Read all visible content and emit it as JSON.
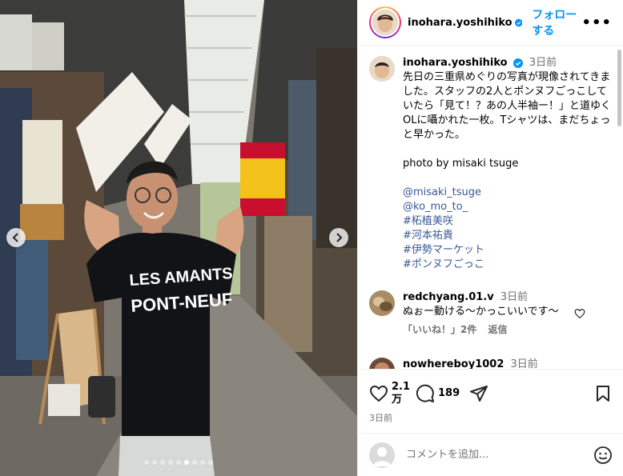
{
  "post": {
    "username": "inohara.yoshihiko",
    "follow_label": "フォローする",
    "more_label": "•••",
    "image_caption_shirt_line1": "LES AMANTS",
    "image_caption_shirt_line2": "PONT-NEUF",
    "carousel": {
      "total": 9,
      "active": 5
    }
  },
  "caption": {
    "username": "inohara.yoshihiko",
    "time": "3日前",
    "text": "先日の三重県めぐりの写真が現像されてきました。スタッフの2人とポンヌフごっこしていたら「見て！？あの人半袖ー！」と道ゆくOLに囁かれた一枚。Tシャツは、まだちょっと早かった。",
    "credit": "photo by misaki tsuge",
    "tags": [
      "@misaki_tsuge",
      "@ko_mo_to_",
      "#柘植美咲",
      "#河本祐貴",
      "#伊勢マーケット",
      "#ポンヌフごっこ"
    ]
  },
  "comments": [
    {
      "username": "redchyang.01.v",
      "time": "3日前",
      "text": "ぬぉー動ける〜かっこいいです〜",
      "likes": "「いいね！」2件",
      "reply": "返信"
    },
    {
      "username": "nowhereboy1002",
      "time": "3日前"
    }
  ],
  "actions": {
    "likes_count": "2.1万",
    "comments_count": "189",
    "date": "3日前"
  },
  "add_comment": {
    "placeholder": "コメントを追加..."
  },
  "colors": {
    "link": "#385898",
    "follow": "#0095f6",
    "verified": "#0095f6"
  }
}
